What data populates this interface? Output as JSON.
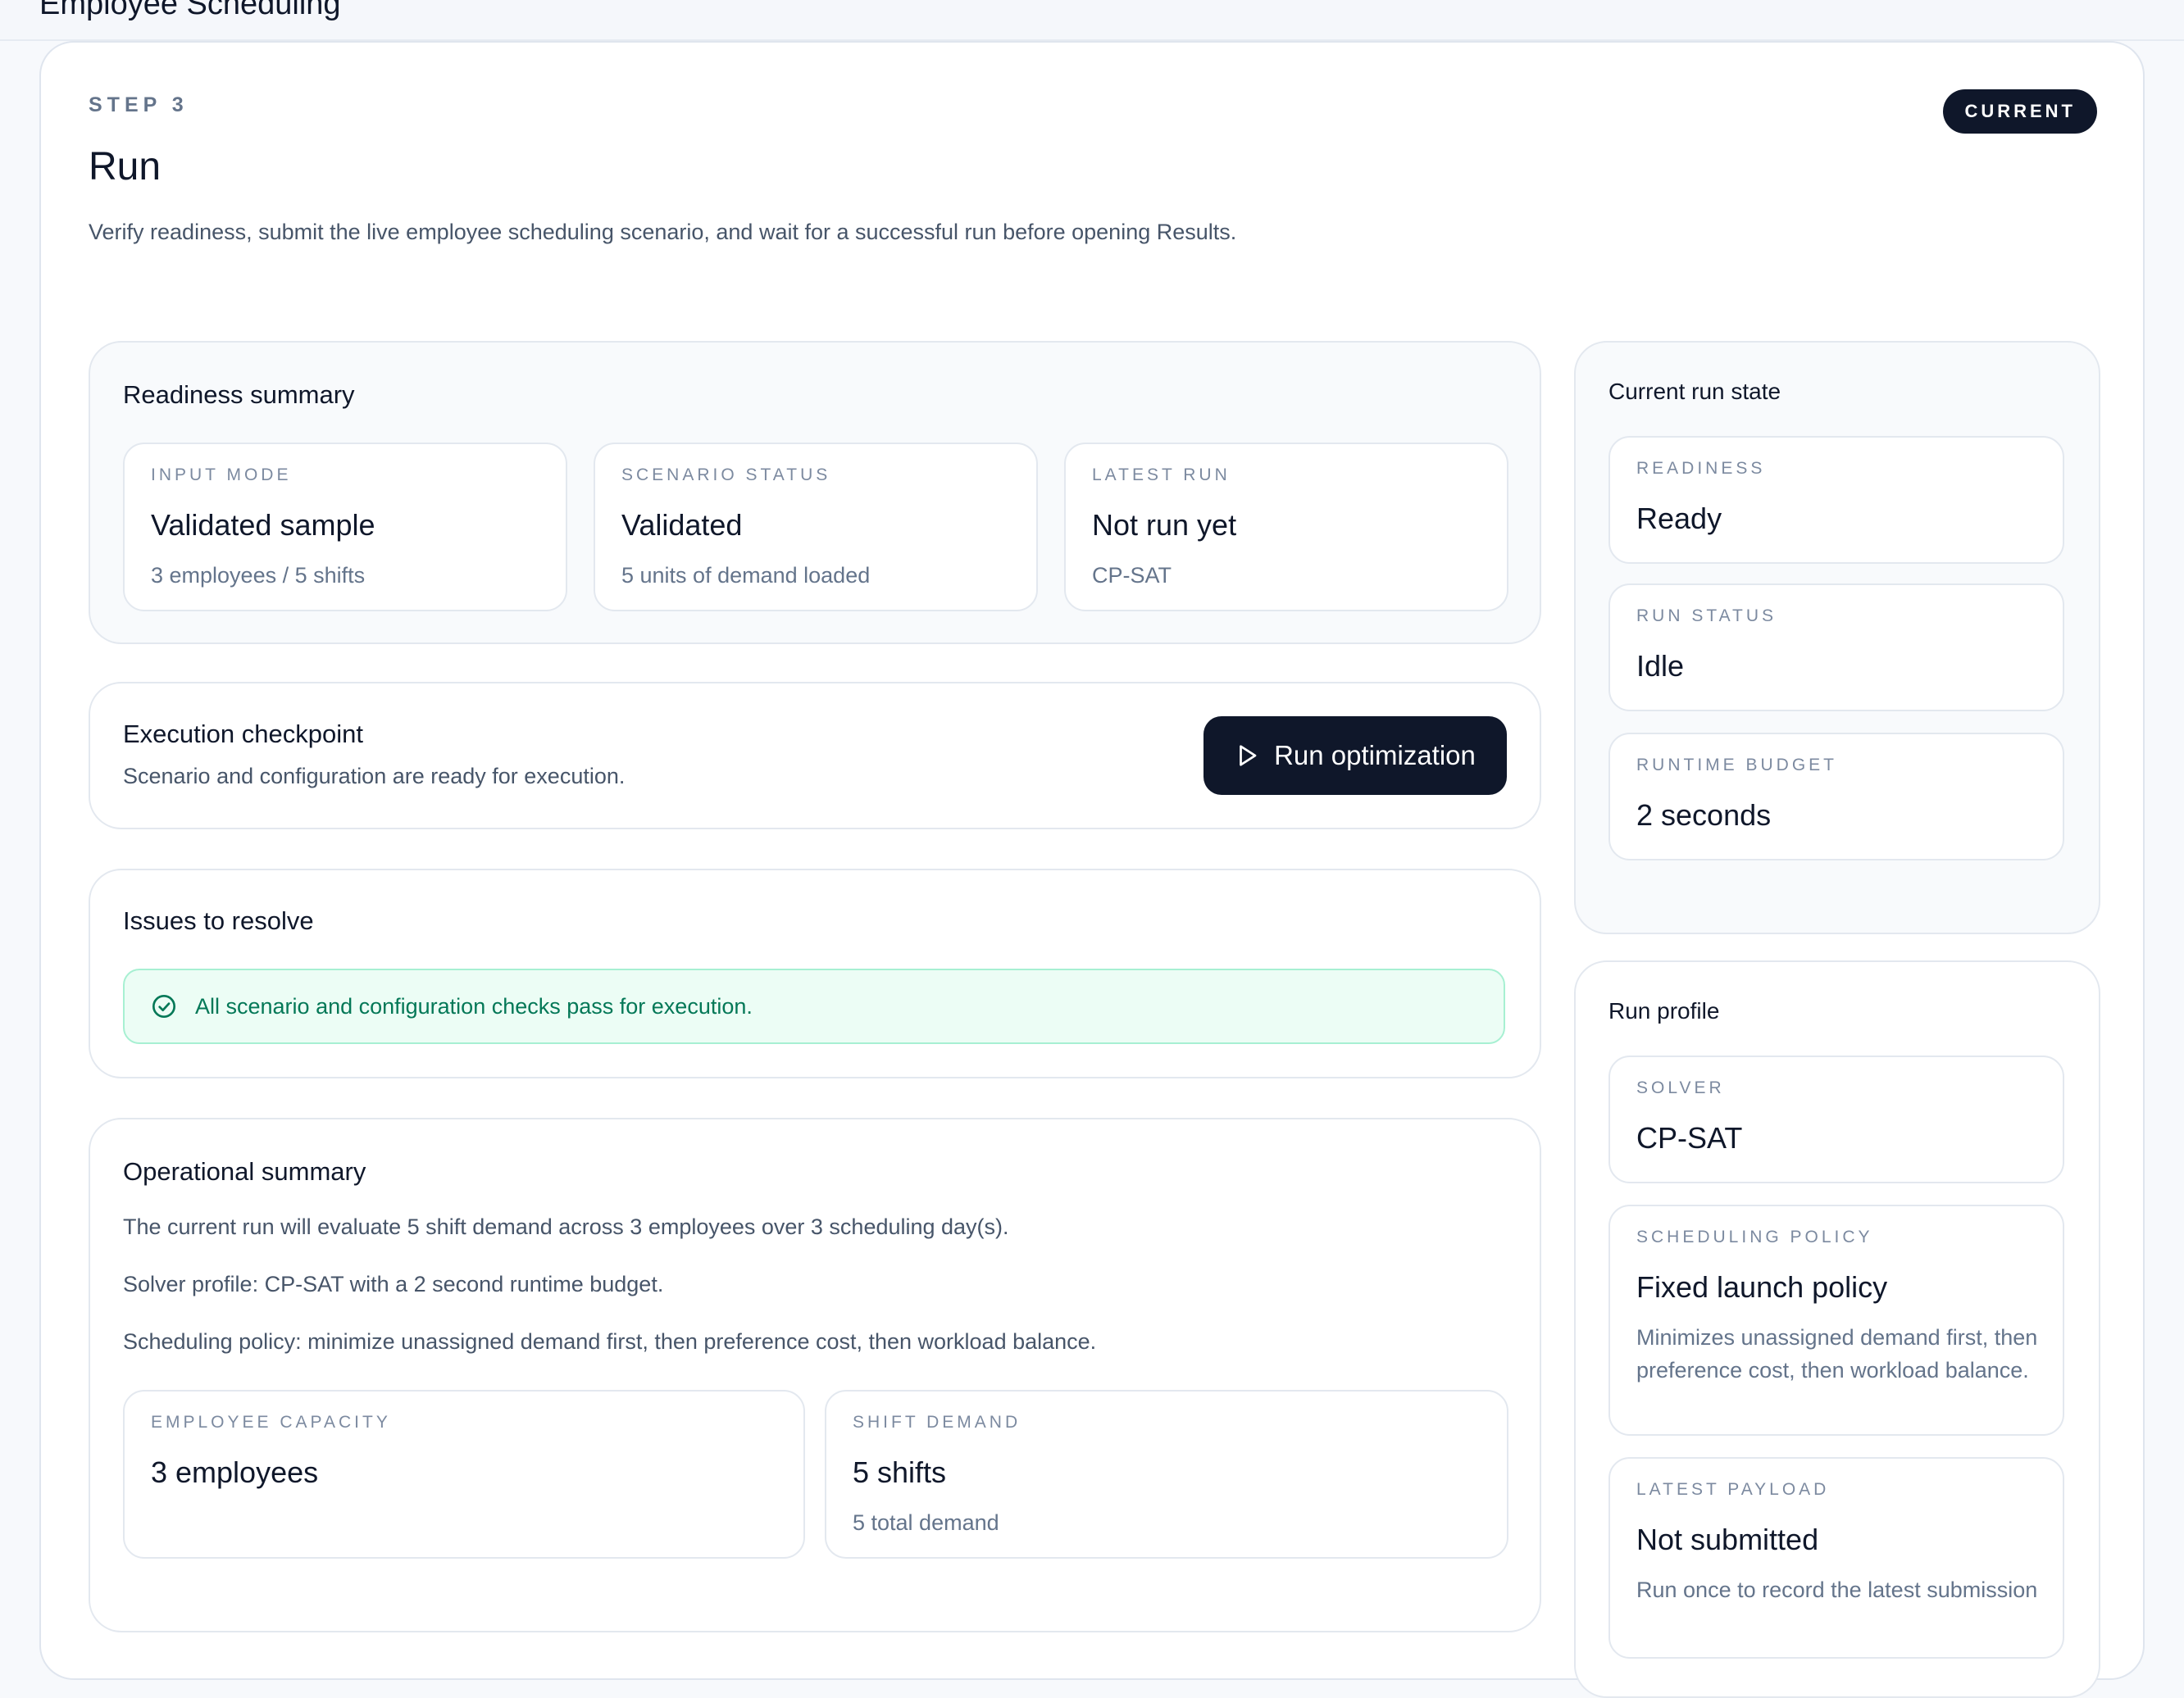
{
  "app": {
    "title": "Employee Scheduling"
  },
  "step": {
    "label": "STEP 3",
    "badge": "CURRENT",
    "title": "Run",
    "description": "Verify readiness, submit the live employee scheduling scenario, and wait for a successful run before opening Results."
  },
  "readiness": {
    "title": "Readiness summary",
    "tiles": [
      {
        "label": "INPUT MODE",
        "value": "Validated sample",
        "sub": "3 employees / 5 shifts"
      },
      {
        "label": "SCENARIO STATUS",
        "value": "Validated",
        "sub": "5 units of demand loaded"
      },
      {
        "label": "LATEST RUN",
        "value": "Not run yet",
        "sub": "CP-SAT"
      }
    ]
  },
  "checkpoint": {
    "title": "Execution checkpoint",
    "message": "Scenario and configuration are ready for execution.",
    "button_label": "Run optimization"
  },
  "issues": {
    "title": "Issues to resolve",
    "ok_message": "All scenario and configuration checks pass for execution."
  },
  "operational": {
    "title": "Operational summary",
    "lines": [
      "The current run will evaluate 5 shift demand across 3 employees over 3 scheduling day(s).",
      "Solver profile: CP-SAT with a 2 second runtime budget.",
      "Scheduling policy: minimize unassigned demand first, then preference cost, then workload balance."
    ],
    "tiles": [
      {
        "label": "EMPLOYEE CAPACITY",
        "value": "3 employees",
        "sub": ""
      },
      {
        "label": "SHIFT DEMAND",
        "value": "5 shifts",
        "sub": "5 total demand"
      }
    ]
  },
  "run_state": {
    "title": "Current run state",
    "tiles": [
      {
        "label": "READINESS",
        "value": "Ready"
      },
      {
        "label": "RUN STATUS",
        "value": "Idle"
      },
      {
        "label": "RUNTIME BUDGET",
        "value": "2 seconds"
      }
    ]
  },
  "run_profile": {
    "title": "Run profile",
    "tiles": [
      {
        "label": "SOLVER",
        "value": "CP-SAT",
        "sub": ""
      },
      {
        "label": "SCHEDULING POLICY",
        "value": "Fixed launch policy",
        "sub": "Minimizes unassigned demand first, then preference cost, then workload balance."
      },
      {
        "label": "LATEST PAYLOAD",
        "value": "Not submitted",
        "sub": "Run once to record the latest submission"
      }
    ]
  },
  "colors": {
    "primary": "#0f172a",
    "success_bg": "#ecfdf5",
    "success_text": "#047857",
    "muted": "#64748b"
  }
}
